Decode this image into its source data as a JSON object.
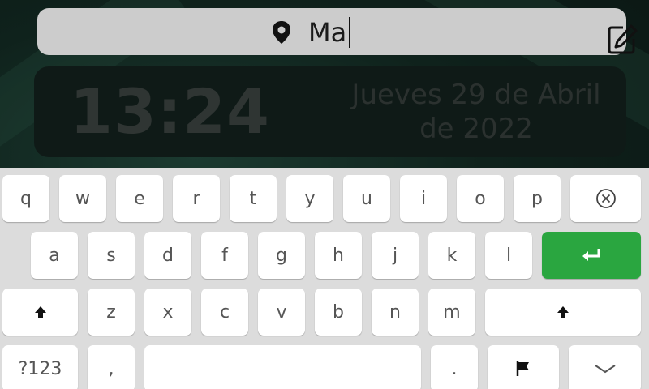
{
  "search": {
    "query": "Ma"
  },
  "clock": {
    "time": "13:24",
    "date_line1": "Jueves 29 de Abril",
    "date_line2": "de 2022"
  },
  "keyboard": {
    "row1": [
      "q",
      "w",
      "e",
      "r",
      "t",
      "y",
      "u",
      "i",
      "o",
      "p"
    ],
    "row2": [
      "a",
      "s",
      "d",
      "f",
      "g",
      "h",
      "j",
      "k",
      "l"
    ],
    "row3": [
      "z",
      "x",
      "c",
      "v",
      "b",
      "n",
      "m"
    ],
    "symbols_label": "?123",
    "comma_label": ",",
    "period_label": ".",
    "icons": {
      "backspace": "backspace-icon",
      "enter": "enter-icon",
      "shift": "shift-icon",
      "flag": "flag-icon",
      "hide": "chevron-down-icon"
    },
    "enter_color": "#2aa640"
  },
  "colors": {
    "search_bg": "#cccccc",
    "card_bg": "#0f1a17",
    "keyboard_bg": "#dcdcdc"
  }
}
